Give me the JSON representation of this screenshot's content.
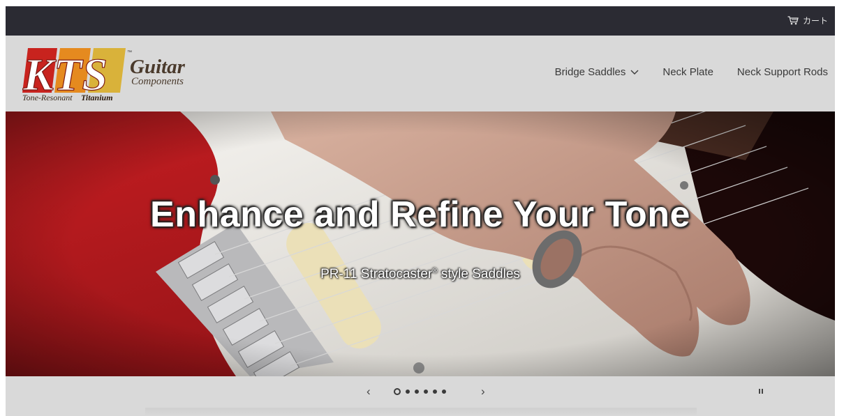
{
  "cart": {
    "label": "カート",
    "icon": "cart-icon"
  },
  "logo": {
    "letters": "KTS",
    "tm": "™",
    "line1": "Guitar",
    "line2": "Components",
    "tagline_a": "Tone-Resonant",
    "tagline_b": "Titanium"
  },
  "nav": {
    "items": [
      {
        "label": "Bridge Saddles",
        "dropdown": true
      },
      {
        "label": "Neck Plate"
      },
      {
        "label": "Neck Support Rods"
      }
    ]
  },
  "hero": {
    "title": "Enhance and Refine Your Tone",
    "subtitle_pre": "PR-11 Stratocaster",
    "subtitle_reg": "®",
    "subtitle_post": " style Saddles"
  },
  "slider": {
    "prev": "‹",
    "next": "›",
    "slide_count": 6,
    "active_index": 0
  },
  "colors": {
    "topbar": "#2b2b33",
    "header_bg": "#d9d9d9",
    "logo_red": "#c8231e",
    "logo_orange": "#e58a1f",
    "logo_brown": "#5a3a22"
  }
}
